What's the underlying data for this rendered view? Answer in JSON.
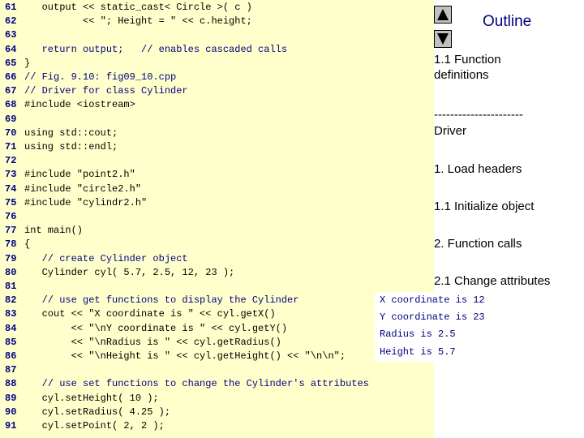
{
  "code_lines": [
    {
      "n": "61",
      "text": "   output << static_cast< Circle >( c )"
    },
    {
      "n": "62",
      "text": "          << \"; Height = \" << c.height;"
    },
    {
      "n": "63",
      "text": ""
    },
    {
      "n": "64",
      "text": "   return output;   // enables cascaded calls"
    },
    {
      "n": "65",
      "text": "}"
    },
    {
      "n": "66",
      "text": "// Fig. 9.10: fig09_10.cpp"
    },
    {
      "n": "67",
      "text": "// Driver for class Cylinder"
    },
    {
      "n": "68",
      "text": "#include <iostream>"
    },
    {
      "n": "69",
      "text": ""
    },
    {
      "n": "70",
      "text": "using std::cout;"
    },
    {
      "n": "71",
      "text": "using std::endl;"
    },
    {
      "n": "72",
      "text": ""
    },
    {
      "n": "73",
      "text": "#include \"point2.h\""
    },
    {
      "n": "74",
      "text": "#include \"circle2.h\""
    },
    {
      "n": "75",
      "text": "#include \"cylindr2.h\""
    },
    {
      "n": "76",
      "text": ""
    },
    {
      "n": "77",
      "text": "int main()"
    },
    {
      "n": "78",
      "text": "{"
    },
    {
      "n": "79",
      "text": "   // create Cylinder object"
    },
    {
      "n": "80",
      "text": "   Cylinder cyl( 5.7, 2.5, 12, 23 );"
    },
    {
      "n": "81",
      "text": ""
    },
    {
      "n": "82",
      "text": "   // use get functions to display the Cylinder"
    },
    {
      "n": "83",
      "text": "   cout << \"X coordinate is \" << cyl.getX()"
    },
    {
      "n": "84",
      "text": "        << \"\\nY coordinate is \" << cyl.getY()"
    },
    {
      "n": "85",
      "text": "        << \"\\nRadius is \" << cyl.getRadius()"
    },
    {
      "n": "86",
      "text": "        << \"\\nHeight is \" << cyl.getHeight() << \"\\n\\n\";"
    },
    {
      "n": "87",
      "text": ""
    },
    {
      "n": "88",
      "text": "   // use set functions to change the Cylinder's attributes"
    },
    {
      "n": "89",
      "text": "   cyl.setHeight( 10 );"
    },
    {
      "n": "90",
      "text": "   cyl.setRadius( 4.25 );"
    },
    {
      "n": "91",
      "text": "   cyl.setPoint( 2, 2 );"
    }
  ],
  "nav": {
    "up_icon": "triangle-up-icon",
    "down_icon": "triangle-down-icon"
  },
  "outline_title": "Outline",
  "sidebar": [
    {
      "text": "1.1 Function definitions"
    },
    {
      "text": "----------------------"
    },
    {
      "text": "Driver"
    },
    {
      "text": "1. Load headers"
    },
    {
      "text": "1.1 Initialize object"
    },
    {
      "text": "2. Function calls"
    },
    {
      "text": "2.1 Change attributes"
    }
  ],
  "program_output": [
    "X coordinate is 12",
    "Y coordinate is 23",
    "Radius is 2.5",
    "Height is 5.7"
  ],
  "colors": {
    "code_background": "#ffffcc",
    "code_text": "#000080"
  }
}
